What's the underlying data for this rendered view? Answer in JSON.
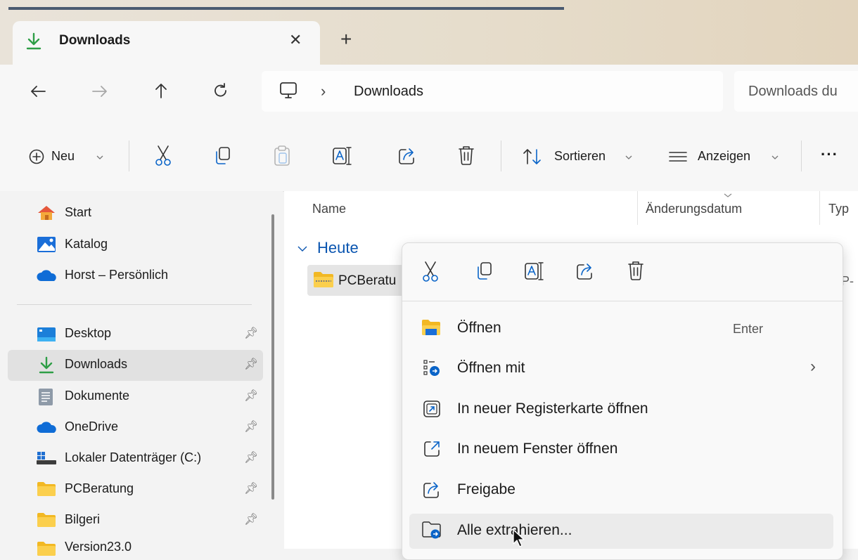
{
  "tab": {
    "title": "Downloads",
    "close": "✕",
    "new_tab": "+"
  },
  "address": {
    "crumb": "Downloads",
    "separator": "›",
    "search_placeholder": "Downloads du"
  },
  "toolbar": {
    "new_label": "Neu",
    "sort_label": "Sortieren",
    "view_label": "Anzeigen",
    "more": "···"
  },
  "columns": {
    "name": "Name",
    "date": "Änderungsdatum",
    "type": "Typ"
  },
  "group": {
    "label": "Heute"
  },
  "file": {
    "name": "PCBeratu",
    "type_partial": "P-"
  },
  "sidebar": {
    "top": [
      {
        "label": "Start"
      },
      {
        "label": "Katalog"
      },
      {
        "label": "Horst – Persönlich"
      }
    ],
    "pinned": [
      {
        "label": "Desktop"
      },
      {
        "label": "Downloads"
      },
      {
        "label": "Dokumente"
      },
      {
        "label": "OneDrive"
      },
      {
        "label": "Lokaler Datenträger (C:)"
      },
      {
        "label": "PCBeratung"
      },
      {
        "label": "Bilgeri"
      },
      {
        "label": "Version23.0"
      }
    ]
  },
  "context_menu": {
    "items": [
      {
        "label": "Öffnen",
        "shortcut": "Enter"
      },
      {
        "label": "Öffnen mit",
        "arrow": "›"
      },
      {
        "label": "In neuer Registerkarte öffnen"
      },
      {
        "label": "In neuem Fenster öffnen"
      },
      {
        "label": "Freigabe"
      },
      {
        "label": "Alle extrahieren..."
      }
    ]
  },
  "colors": {
    "accent": "#0a64c8",
    "folder_yellow": "#f2b823",
    "onedrive_blue": "#0f6cd6",
    "download_green": "#2e9e46"
  }
}
